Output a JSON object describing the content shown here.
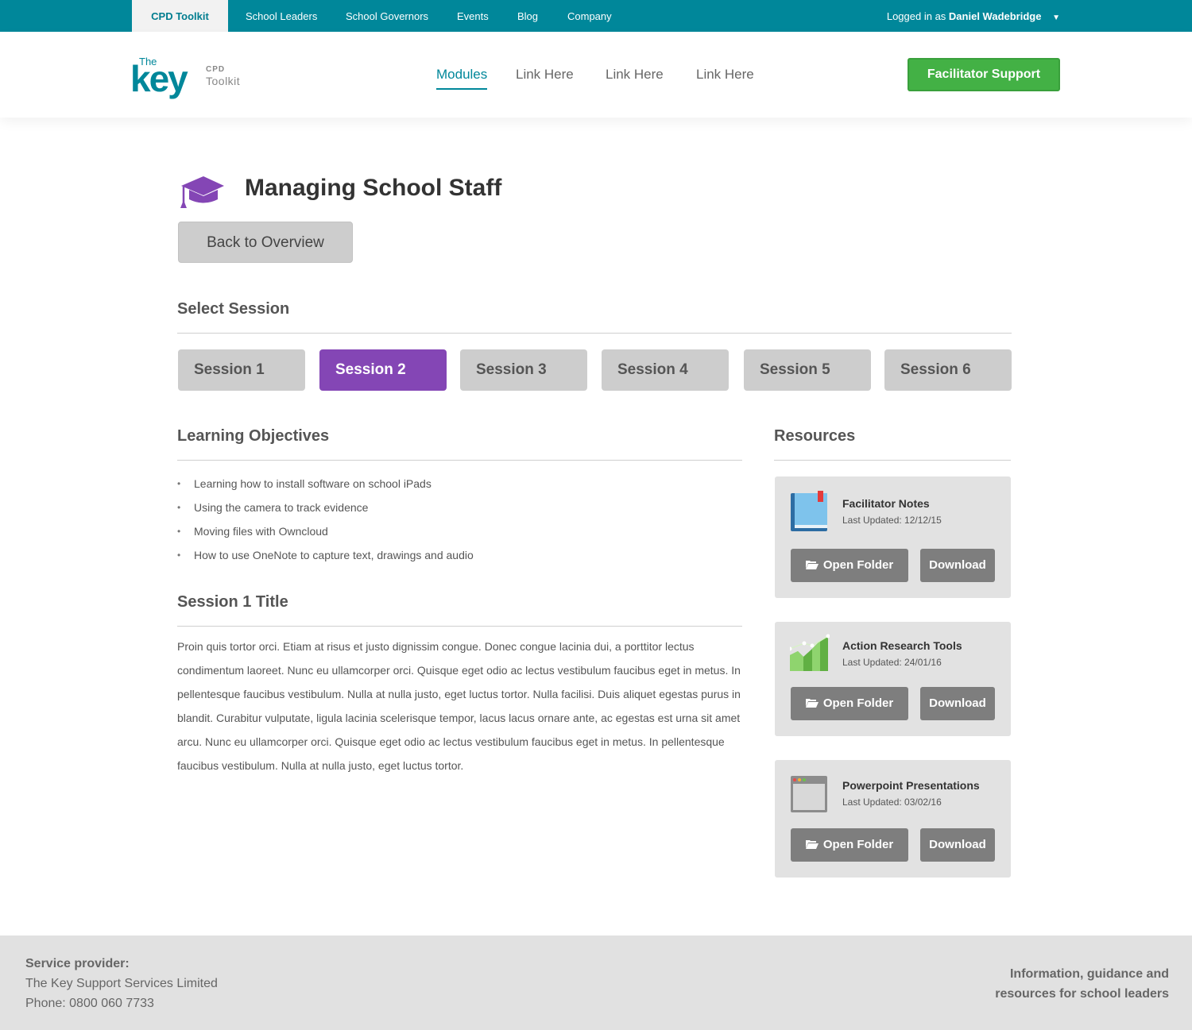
{
  "topbar": {
    "tabs": [
      "CPD Toolkit",
      "School Leaders",
      "School Governors",
      "Events",
      "Blog",
      "Company"
    ],
    "user_prefix": "Logged in as",
    "user_name": "Daniel Wadebridge",
    "caret": "▼"
  },
  "header": {
    "logo_the": "The",
    "logo_key": "key",
    "logo_cpd": "CPD",
    "logo_toolkit": "Toolkit",
    "nav": [
      "Modules",
      "Link Here",
      "Link Here",
      "Link Here"
    ],
    "support_button": "Facilitator Support"
  },
  "main": {
    "title": "Managing School Staff",
    "back_button": "Back to Overview",
    "select_session_heading": "Select Session",
    "sessions": [
      "Session 1",
      "Session 2",
      "Session 3",
      "Session 4",
      "Session 5",
      "Session 6"
    ],
    "active_session": "Session 2",
    "objectives_heading": "Learning Objectives",
    "objectives": [
      "Learning how to install software on school iPads",
      "Using the camera to track evidence",
      "Moving files with Owncloud",
      "How to use OneNote to capture text, drawings and audio"
    ],
    "session_title": "Session 1 Title",
    "session_body": "Proin quis tortor orci. Etiam at risus et justo dignissim congue. Donec congue lacinia dui, a porttitor lectus condimentum laoreet. Nunc eu ullamcorper orci. Quisque eget odio ac lectus vestibulum faucibus eget in metus. In pellentesque faucibus vestibulum. Nulla at nulla justo, eget luctus tortor. Nulla facilisi. Duis aliquet egestas purus in blandit. Curabitur vulputate, ligula lacinia scelerisque tempor, lacus lacus ornare ante, ac egestas est urna sit amet arcu. Nunc eu ullamcorper orci. Quisque eget odio ac lectus vestibulum faucibus eget in metus. In pellentesque faucibus vestibulum. Nulla at nulla justo, eget luctus tortor."
  },
  "resources": {
    "heading": "Resources",
    "items": [
      {
        "title": "Facilitator Notes",
        "updated": "Last Updated: 12/12/15",
        "icon": "book-icon",
        "open": "Open Folder",
        "download": "Download"
      },
      {
        "title": "Action Research Tools",
        "updated": "Last Updated: 24/01/16",
        "icon": "chart-icon",
        "open": "Open Folder",
        "download": "Download"
      },
      {
        "title": "Powerpoint Presentations",
        "updated": "Last Updated: 03/02/16",
        "icon": "window-icon",
        "open": "Open Folder",
        "download": "Download"
      }
    ]
  },
  "footer": {
    "provider_label": "Service provider:",
    "provider_name": "The Key Support Services Limited",
    "phone": "Phone: 0800 060 7733",
    "tagline_1": "Information, guidance and",
    "tagline_2": "resources for school leaders"
  },
  "colors": {
    "brand_teal": "#00879a",
    "session_active": "#8446b5",
    "support_green": "#43b145",
    "button_grey": "#7e7e7e"
  }
}
